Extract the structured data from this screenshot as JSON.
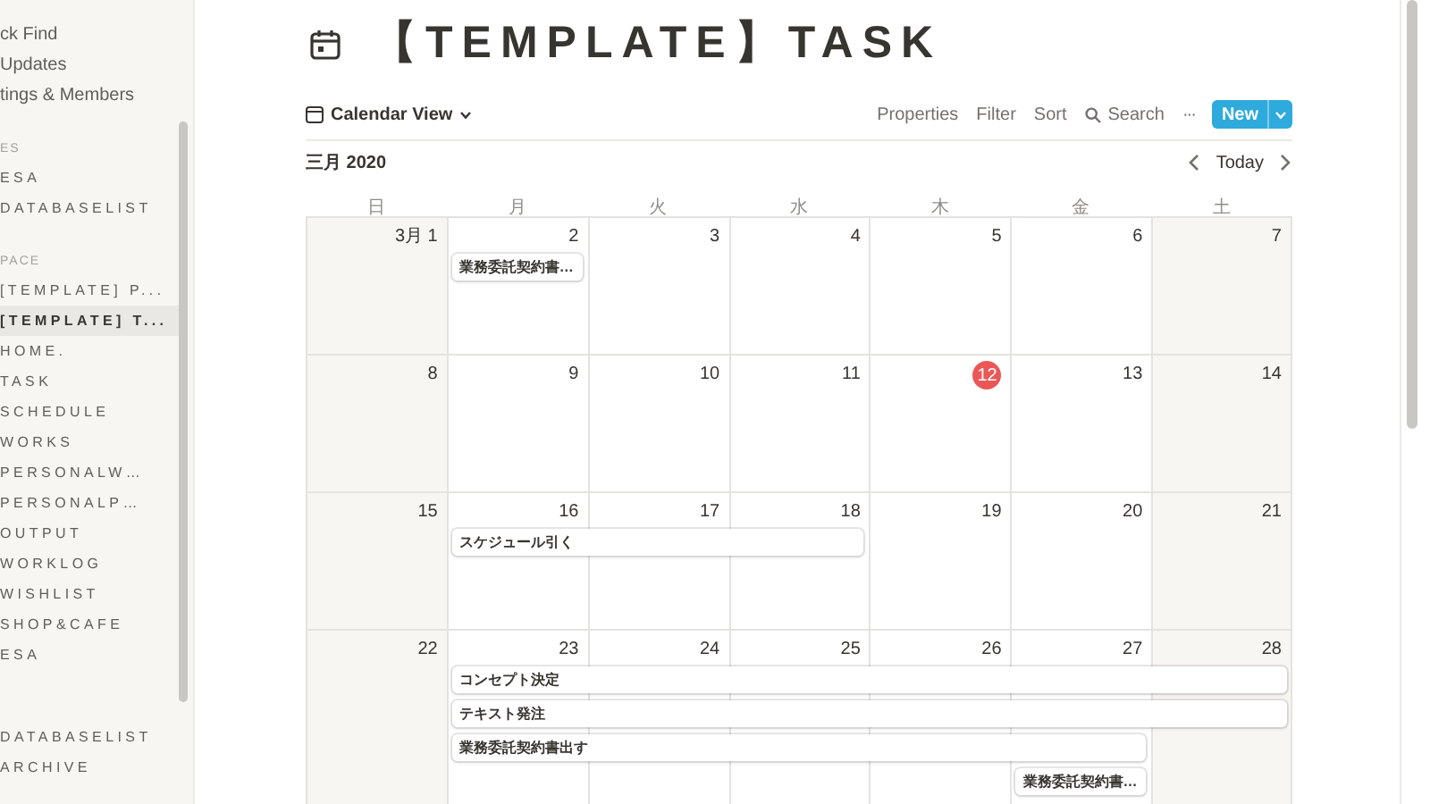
{
  "sidebar": {
    "top_items": [
      {
        "label": "ck Find"
      },
      {
        "label": "Updates"
      },
      {
        "label": "tings & Members"
      }
    ],
    "sections": [
      {
        "header": "ES",
        "items": [
          {
            "label": "ESA",
            "selected": false
          },
          {
            "label": "DATABASELIST",
            "selected": false
          }
        ]
      },
      {
        "header": "PACE",
        "items": [
          {
            "label": "[TEMPLATE] P...",
            "selected": false
          },
          {
            "label": "[TEMPLATE] T...",
            "selected": true
          },
          {
            "label": "HOME.",
            "selected": false
          },
          {
            "label": "TASK",
            "selected": false
          },
          {
            "label": "SCHEDULE",
            "selected": false
          },
          {
            "label": "WORKS",
            "selected": false
          },
          {
            "label": "PERSONALW…",
            "selected": false
          },
          {
            "label": "PERSONALP…",
            "selected": false
          },
          {
            "label": "OUTPUT",
            "selected": false
          },
          {
            "label": "WORKLOG",
            "selected": false
          },
          {
            "label": "WISHLIST",
            "selected": false
          },
          {
            "label": "SHOP&CAFE",
            "selected": false
          },
          {
            "label": "ESA",
            "selected": false
          }
        ]
      },
      {
        "items": [
          {
            "label": "DATABASELIST",
            "selected": false
          },
          {
            "label": "ARCHIVE",
            "selected": false
          }
        ]
      }
    ]
  },
  "page": {
    "title": "【TEMPLATE】TASK"
  },
  "toolbar": {
    "view": "Calendar View",
    "actions": [
      "Properties",
      "Filter",
      "Sort"
    ],
    "search": "Search",
    "more": "···",
    "new_button": "New"
  },
  "calendar": {
    "month": "三月 2020",
    "today_button": "Today",
    "weekdays": [
      "日",
      "月",
      "火",
      "水",
      "木",
      "金",
      "土"
    ],
    "weeks": [
      {
        "days": [
          {
            "label": "3月 1",
            "shaded": true
          },
          {
            "label": "2",
            "shaded": false,
            "events": [
              {
                "kind": "start",
                "title": "業務委託契約書…"
              }
            ]
          },
          {
            "label": "3",
            "shaded": false
          },
          {
            "label": "4",
            "shaded": false
          },
          {
            "label": "5",
            "shaded": false
          },
          {
            "label": "6",
            "shaded": false
          },
          {
            "label": "7",
            "shaded": true
          }
        ]
      },
      {
        "days": [
          {
            "label": "8",
            "shaded": true
          },
          {
            "label": "9",
            "shaded": false
          },
          {
            "label": "10",
            "shaded": false
          },
          {
            "label": "11",
            "shaded": false
          },
          {
            "label": "12",
            "shaded": false,
            "today": true
          },
          {
            "label": "13",
            "shaded": false
          },
          {
            "label": "14",
            "shaded": true
          }
        ]
      },
      {
        "days": [
          {
            "label": "15",
            "shaded": true
          },
          {
            "label": "16",
            "shaded": false,
            "events": [
              {
                "kind": "start",
                "title": "スケジュール引く"
              }
            ]
          },
          {
            "label": "17",
            "shaded": false,
            "events": [
              {
                "kind": "continued"
              }
            ]
          },
          {
            "label": "18",
            "shaded": false,
            "events": [
              {
                "kind": "continued"
              }
            ]
          },
          {
            "label": "19",
            "shaded": false
          },
          {
            "label": "20",
            "shaded": false
          },
          {
            "label": "21",
            "shaded": true
          }
        ]
      },
      {
        "days": [
          {
            "label": "22",
            "shaded": true
          },
          {
            "label": "23",
            "shaded": false,
            "events": [
              {
                "kind": "start",
                "title": "コンセプト決定"
              },
              {
                "kind": "start",
                "title": "テキスト発注"
              },
              {
                "kind": "start",
                "title": "業務委託契約書出す"
              }
            ]
          },
          {
            "label": "24",
            "shaded": false,
            "events": [
              {
                "kind": "continued"
              },
              {
                "kind": "continued"
              },
              {
                "kind": "continued"
              }
            ]
          },
          {
            "label": "25",
            "shaded": false,
            "events": [
              {
                "kind": "continued"
              },
              {
                "kind": "continued"
              },
              {
                "kind": "continued"
              }
            ]
          },
          {
            "label": "26",
            "shaded": false,
            "events": [
              {
                "kind": "continued"
              },
              {
                "kind": "continued"
              },
              {
                "kind": "continued"
              }
            ]
          },
          {
            "label": "27",
            "shaded": false,
            "events": [
              {
                "kind": "continued"
              },
              {
                "kind": "continued"
              },
              {
                "kind": "continued"
              },
              {
                "kind": "start",
                "title": "業務委託契約書…"
              }
            ]
          },
          {
            "label": "28",
            "shaded": true,
            "events": [
              {
                "kind": "continued"
              },
              {
                "kind": "continued"
              }
            ]
          }
        ]
      }
    ]
  }
}
